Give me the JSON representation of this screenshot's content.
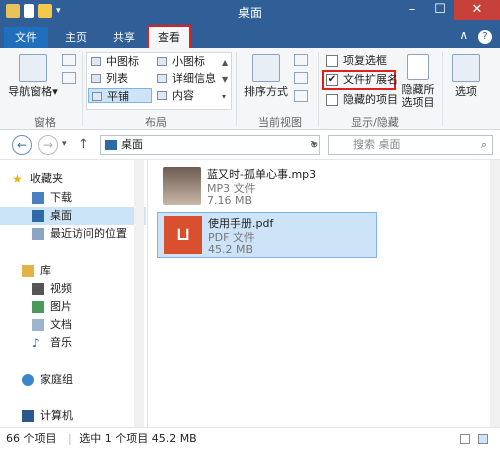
{
  "window": {
    "title": "桌面"
  },
  "tabs": [
    {
      "label": "文件"
    },
    {
      "label": "主页"
    },
    {
      "label": "共享"
    },
    {
      "label": "查看"
    }
  ],
  "ribbon": {
    "pane": {
      "nav_pane": "导航窗格",
      "group": "窗格"
    },
    "layout": {
      "items": [
        "中图标",
        "小图标",
        "列表",
        "详细信息",
        "平铺",
        "内容"
      ],
      "selected": "平铺",
      "group": "布局"
    },
    "current_view": {
      "sort": "排序方式",
      "group": "当前视图"
    },
    "show_hide": {
      "item_checkboxes": {
        "label": "项复选框",
        "checked": false
      },
      "file_extensions": {
        "label": "文件扩展名",
        "checked": true
      },
      "hidden_items": {
        "label": "隐藏的项目",
        "checked": false
      },
      "hide_selected": "隐藏所选项目",
      "group": "显示/隐藏"
    },
    "options": "选项"
  },
  "address": {
    "path": "桌面",
    "search_placeholder": "搜索 桌面"
  },
  "sidebar": {
    "favorites": "收藏夹",
    "downloads": "下载",
    "desktop": "桌面",
    "recent": "最近访问的位置",
    "libraries": "库",
    "videos": "视频",
    "pictures": "图片",
    "documents": "文档",
    "music": "音乐",
    "homegroup": "家庭组",
    "computer": "计算机"
  },
  "files": [
    {
      "name": "蓝又时-孤单心事.mp3",
      "type": "MP3 文件",
      "size": "7.16 MB"
    },
    {
      "name": "使用手册.pdf",
      "type": "PDF 文件",
      "size": "45.2 MB"
    }
  ],
  "status": {
    "count": "66 个项目",
    "selection": "选中 1 个项目 45.2 MB"
  },
  "colors": {
    "accent": "#2f5f96",
    "highlight": "#e02020",
    "pdf": "#d9502f"
  }
}
